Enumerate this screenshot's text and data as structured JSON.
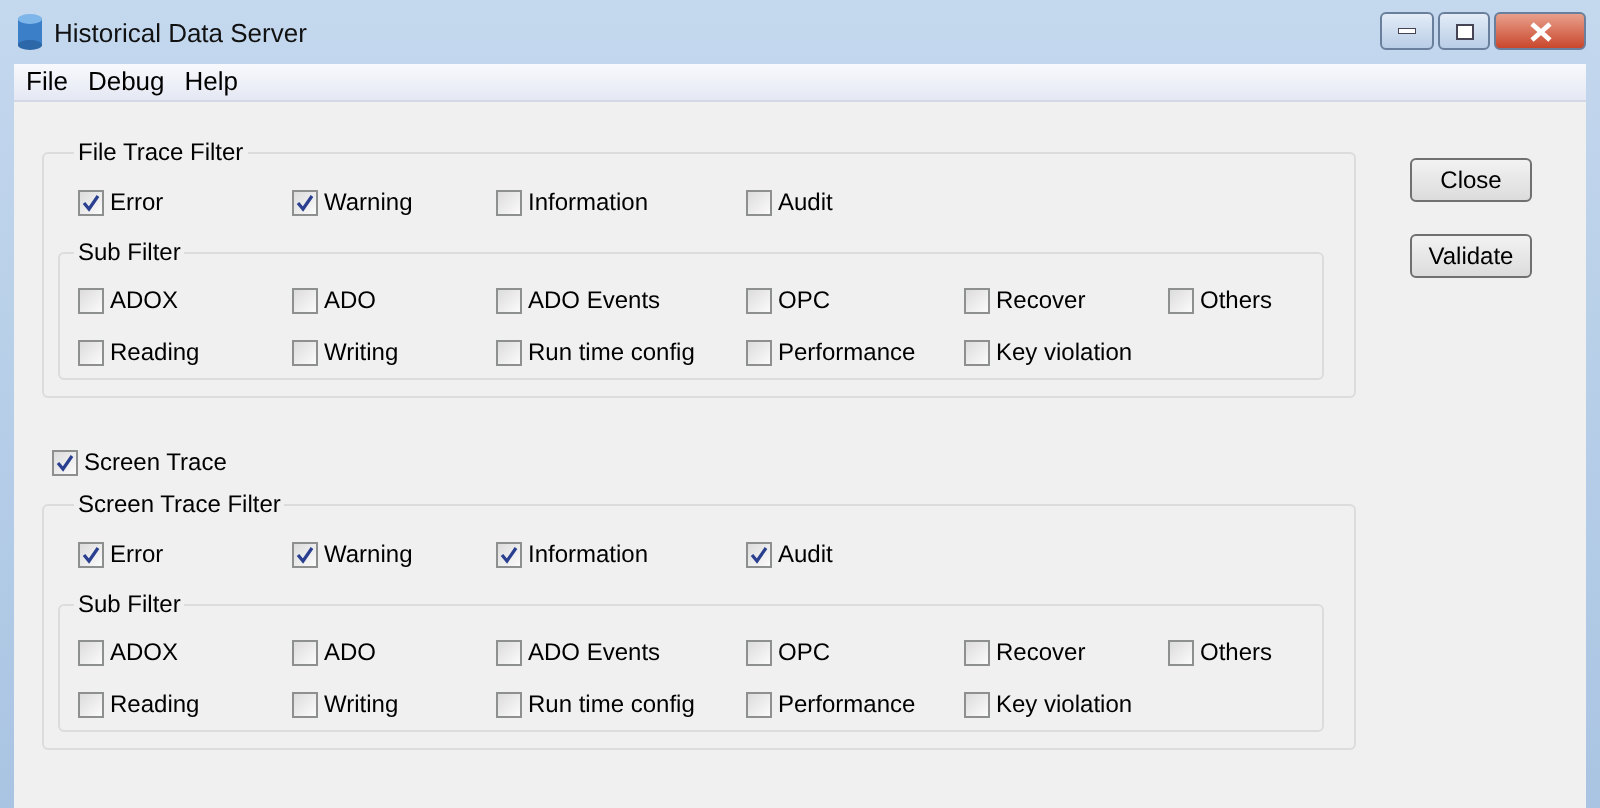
{
  "window": {
    "title": "Historical Data Server"
  },
  "menu": [
    "File",
    "Debug",
    "Help"
  ],
  "file_trace_filter": {
    "title": "File Trace Filter",
    "levels": [
      {
        "label": "Error",
        "checked": true
      },
      {
        "label": "Warning",
        "checked": true
      },
      {
        "label": "Information",
        "checked": false
      },
      {
        "label": "Audit",
        "checked": false
      }
    ],
    "sub_filter": {
      "title": "Sub Filter",
      "items": [
        {
          "label": "ADOX",
          "checked": false
        },
        {
          "label": "ADO",
          "checked": false
        },
        {
          "label": "ADO Events",
          "checked": false
        },
        {
          "label": "OPC",
          "checked": false
        },
        {
          "label": "Recover",
          "checked": false
        },
        {
          "label": "Others",
          "checked": false
        },
        {
          "label": "Reading",
          "checked": false
        },
        {
          "label": "Writing",
          "checked": false
        },
        {
          "label": "Run time config",
          "checked": false
        },
        {
          "label": "Performance",
          "checked": false
        },
        {
          "label": "Key violation",
          "checked": false
        }
      ]
    }
  },
  "screen_trace": {
    "label": "Screen Trace",
    "checked": true
  },
  "screen_trace_filter": {
    "title": "Screen Trace Filter",
    "levels": [
      {
        "label": "Error",
        "checked": true
      },
      {
        "label": "Warning",
        "checked": true
      },
      {
        "label": "Information",
        "checked": true
      },
      {
        "label": "Audit",
        "checked": true
      }
    ],
    "sub_filter": {
      "title": "Sub Filter",
      "items": [
        {
          "label": "ADOX",
          "checked": false
        },
        {
          "label": "ADO",
          "checked": false
        },
        {
          "label": "ADO Events",
          "checked": false
        },
        {
          "label": "OPC",
          "checked": false
        },
        {
          "label": "Recover",
          "checked": false
        },
        {
          "label": "Others",
          "checked": false
        },
        {
          "label": "Reading",
          "checked": false
        },
        {
          "label": "Writing",
          "checked": false
        },
        {
          "label": "Run time config",
          "checked": false
        },
        {
          "label": "Performance",
          "checked": false
        },
        {
          "label": "Key violation",
          "checked": false
        }
      ]
    }
  },
  "buttons": [
    "Close",
    "Validate"
  ]
}
